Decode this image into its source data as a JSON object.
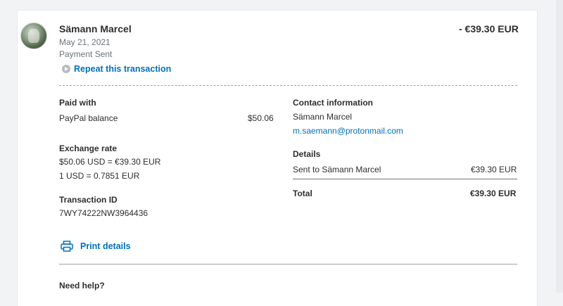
{
  "transaction": {
    "name": "Sämann Marcel",
    "date": "May 21, 2021",
    "status": "Payment Sent",
    "amount": "- €39.30 EUR",
    "repeat_label": "Repeat this transaction"
  },
  "paid_with": {
    "label": "Paid with",
    "method": "PayPal balance",
    "amount": "$50.06"
  },
  "exchange": {
    "label": "Exchange rate",
    "conversion": "$50.06 USD = €39.30 EUR",
    "rate": "1 USD = 0.7851 EUR"
  },
  "txn_id": {
    "label": "Transaction ID",
    "value": "7WY74222NW3964436"
  },
  "contact": {
    "label": "Contact information",
    "name": "Sämann Marcel",
    "email": "m.saemann@protonmail.com"
  },
  "details": {
    "label": "Details",
    "sent_to": "Sent to Sämann Marcel",
    "sent_amount": "€39.30 EUR",
    "total_label": "Total",
    "total_amount": "€39.30 EUR"
  },
  "actions": {
    "print_label": "Print details"
  },
  "help": {
    "label": "Need help?"
  },
  "icons": {
    "repeat": "repeat-arrow-icon",
    "print": "printer-icon"
  },
  "colors": {
    "link": "#0070ba",
    "text": "#2c2e2f",
    "muted": "#6c7378"
  }
}
